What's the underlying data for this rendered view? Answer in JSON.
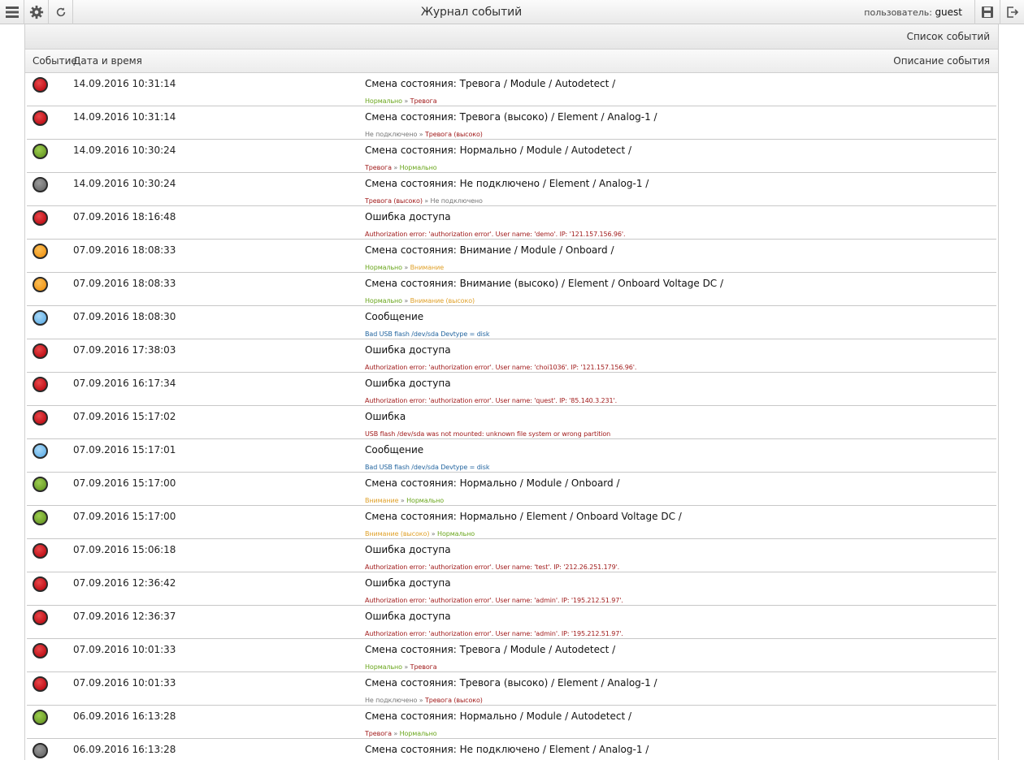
{
  "topbar": {
    "title": "Журнал событий",
    "user_label": "пользователь:",
    "user_name": "guest"
  },
  "panel": {
    "title": "Список событий",
    "columns": {
      "event": "Событие",
      "datetime": "Дата и время",
      "description": "Описание события"
    }
  },
  "colors": {
    "red": "#c3141b",
    "green": "#6fa02a",
    "gray": "#707070",
    "orange": "#f29a1e",
    "blue": "#6cb6ea"
  },
  "events": [
    {
      "status": "red",
      "datetime": "14.09.2016 10:31:14",
      "title": "Смена состояния: Тревога / Module / Autodetect /",
      "sub": [
        {
          "t": "Нормально",
          "c": "green"
        },
        {
          "t": " » ",
          "c": "sep"
        },
        {
          "t": "Тревога",
          "c": "red"
        }
      ]
    },
    {
      "status": "red",
      "datetime": "14.09.2016 10:31:14",
      "title": "Смена состояния: Тревога (высоко) / Element / Analog-1 /",
      "sub": [
        {
          "t": "Не подключено",
          "c": "gray"
        },
        {
          "t": " » ",
          "c": "sep"
        },
        {
          "t": "Тревога (высоко)",
          "c": "red"
        }
      ]
    },
    {
      "status": "green",
      "datetime": "14.09.2016 10:30:24",
      "title": "Смена состояния: Нормально / Module / Autodetect /",
      "sub": [
        {
          "t": "Тревога",
          "c": "red"
        },
        {
          "t": " » ",
          "c": "sep"
        },
        {
          "t": "Нормально",
          "c": "green"
        }
      ]
    },
    {
      "status": "gray",
      "datetime": "14.09.2016 10:30:24",
      "title": "Смена состояния: Не подключено / Element / Analog-1 /",
      "sub": [
        {
          "t": "Тревога (высоко)",
          "c": "red"
        },
        {
          "t": " » ",
          "c": "sep"
        },
        {
          "t": "Не подключено",
          "c": "gray"
        }
      ]
    },
    {
      "status": "red",
      "datetime": "07.09.2016 18:16:48",
      "title": "Ошибка доступа",
      "sub": [
        {
          "t": "Authorization error: 'authorization error'. User name: 'demo'. IP: '121.157.156.96'.",
          "c": "red"
        }
      ]
    },
    {
      "status": "orange",
      "datetime": "07.09.2016 18:08:33",
      "title": "Смена состояния: Внимание / Module / Onboard /",
      "sub": [
        {
          "t": "Нормально",
          "c": "green"
        },
        {
          "t": " » ",
          "c": "sep"
        },
        {
          "t": "Внимание",
          "c": "orange"
        }
      ]
    },
    {
      "status": "orange",
      "datetime": "07.09.2016 18:08:33",
      "title": "Смена состояния: Внимание (высоко) / Element / Onboard Voltage DC /",
      "sub": [
        {
          "t": "Нормально",
          "c": "green"
        },
        {
          "t": " » ",
          "c": "sep"
        },
        {
          "t": "Внимание (высоко)",
          "c": "orange"
        }
      ]
    },
    {
      "status": "blue",
      "datetime": "07.09.2016 18:08:30",
      "title": "Сообщение",
      "sub": [
        {
          "t": "Bad USB flash /dev/sda Devtype = disk",
          "c": "blue"
        }
      ]
    },
    {
      "status": "red",
      "datetime": "07.09.2016 17:38:03",
      "title": "Ошибка доступа",
      "sub": [
        {
          "t": "Authorization error: 'authorization error'. User name: 'choi1036'. IP: '121.157.156.96'.",
          "c": "red"
        }
      ]
    },
    {
      "status": "red",
      "datetime": "07.09.2016 16:17:34",
      "title": "Ошибка доступа",
      "sub": [
        {
          "t": "Authorization error: 'authorization error'. User name: 'quest'. IP: '85.140.3.231'.",
          "c": "red"
        }
      ]
    },
    {
      "status": "red",
      "datetime": "07.09.2016 15:17:02",
      "title": "Ошибка",
      "sub": [
        {
          "t": "USB flash /dev/sda was not mounted: unknown file system or wrong partition",
          "c": "red"
        }
      ]
    },
    {
      "status": "blue",
      "datetime": "07.09.2016 15:17:01",
      "title": "Сообщение",
      "sub": [
        {
          "t": "Bad USB flash /dev/sda Devtype = disk",
          "c": "blue"
        }
      ]
    },
    {
      "status": "green",
      "datetime": "07.09.2016 15:17:00",
      "title": "Смена состояния: Нормально / Module / Onboard /",
      "sub": [
        {
          "t": "Внимание",
          "c": "orange"
        },
        {
          "t": " » ",
          "c": "sep"
        },
        {
          "t": "Нормально",
          "c": "green"
        }
      ]
    },
    {
      "status": "green",
      "datetime": "07.09.2016 15:17:00",
      "title": "Смена состояния: Нормально / Element / Onboard Voltage DC /",
      "sub": [
        {
          "t": "Внимание (высоко)",
          "c": "orange"
        },
        {
          "t": " » ",
          "c": "sep"
        },
        {
          "t": "Нормально",
          "c": "green"
        }
      ]
    },
    {
      "status": "red",
      "datetime": "07.09.2016 15:06:18",
      "title": "Ошибка доступа",
      "sub": [
        {
          "t": "Authorization error: 'authorization error'. User name: 'test'. IP: '212.26.251.179'.",
          "c": "red"
        }
      ]
    },
    {
      "status": "red",
      "datetime": "07.09.2016 12:36:42",
      "title": "Ошибка доступа",
      "sub": [
        {
          "t": "Authorization error: 'authorization error'. User name: 'admin'. IP: '195.212.51.97'.",
          "c": "red"
        }
      ]
    },
    {
      "status": "red",
      "datetime": "07.09.2016 12:36:37",
      "title": "Ошибка доступа",
      "sub": [
        {
          "t": "Authorization error: 'authorization error'. User name: 'admin'. IP: '195.212.51.97'.",
          "c": "red"
        }
      ]
    },
    {
      "status": "red",
      "datetime": "07.09.2016 10:01:33",
      "title": "Смена состояния: Тревога / Module / Autodetect /",
      "sub": [
        {
          "t": "Нормально",
          "c": "green"
        },
        {
          "t": " » ",
          "c": "sep"
        },
        {
          "t": "Тревога",
          "c": "red"
        }
      ]
    },
    {
      "status": "red",
      "datetime": "07.09.2016 10:01:33",
      "title": "Смена состояния: Тревога (высоко) / Element / Analog-1 /",
      "sub": [
        {
          "t": "Не подключено",
          "c": "gray"
        },
        {
          "t": " » ",
          "c": "sep"
        },
        {
          "t": "Тревога (высоко)",
          "c": "red"
        }
      ]
    },
    {
      "status": "green",
      "datetime": "06.09.2016 16:13:28",
      "title": "Смена состояния: Нормально / Module / Autodetect /",
      "sub": [
        {
          "t": "Тревога",
          "c": "red"
        },
        {
          "t": " » ",
          "c": "sep"
        },
        {
          "t": "Нормально",
          "c": "green"
        }
      ]
    },
    {
      "status": "gray",
      "datetime": "06.09.2016 16:13:28",
      "title": "Смена состояния: Не подключено / Element / Analog-1 /",
      "sub": []
    }
  ]
}
